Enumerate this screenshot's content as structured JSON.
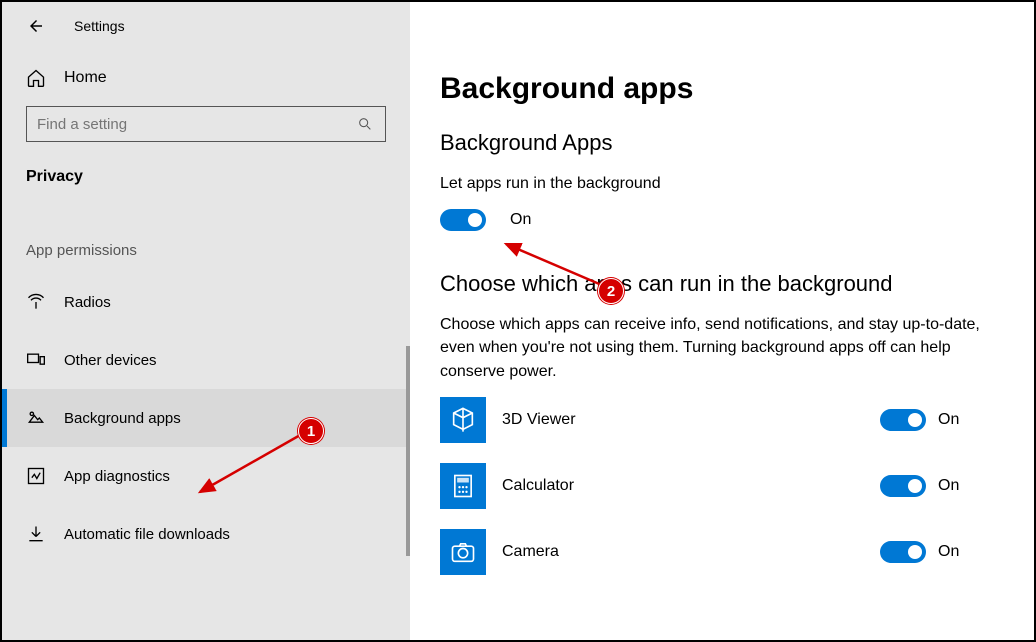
{
  "titlebar": {
    "title": "Settings"
  },
  "sidebar": {
    "home_label": "Home",
    "search_placeholder": "Find a setting",
    "group_strong": "Privacy",
    "group_label": "App permissions",
    "items": [
      {
        "id": "radios",
        "label": "Radios"
      },
      {
        "id": "other-devices",
        "label": "Other devices"
      },
      {
        "id": "background-apps",
        "label": "Background apps"
      },
      {
        "id": "app-diagnostics",
        "label": "App diagnostics"
      },
      {
        "id": "automatic-file-downloads",
        "label": "Automatic file downloads"
      }
    ]
  },
  "main": {
    "page_title": "Background apps",
    "section1_heading": "Background Apps",
    "section1_text": "Let apps run in the background",
    "section1_toggle_state": "On",
    "section2_heading": "Choose which apps can run in the background",
    "section2_text": "Choose which apps can receive info, send notifications, and stay up-to-date, even when you're not using them. Turning background apps off can help conserve power.",
    "apps": [
      {
        "name": "3D Viewer",
        "state": "On"
      },
      {
        "name": "Calculator",
        "state": "On"
      },
      {
        "name": "Camera",
        "state": "On"
      }
    ]
  },
  "annotations": {
    "badge1": "1",
    "badge2": "2"
  }
}
